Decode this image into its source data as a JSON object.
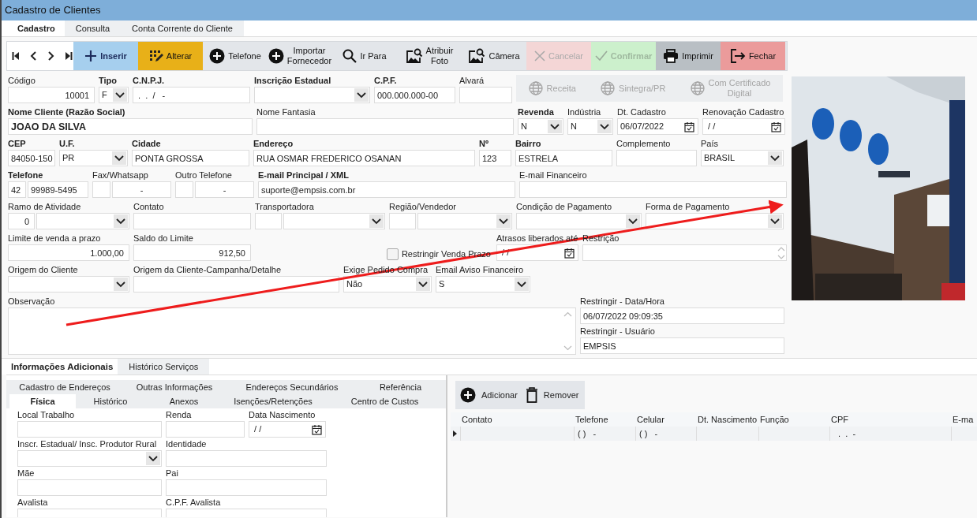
{
  "window": {
    "title": "Cadastro de Clientes"
  },
  "tabs": [
    {
      "label": "Cadastro",
      "selected": true
    },
    {
      "label": "Consulta",
      "selected": false
    },
    {
      "label": "Conta Corrente do Cliente",
      "selected": false
    }
  ],
  "toolbar": {
    "navigation": [
      {
        "kind": "first"
      },
      {
        "kind": "prev"
      },
      {
        "kind": "next"
      },
      {
        "kind": "last"
      }
    ],
    "buttons": [
      {
        "label": "Inserir",
        "kind": "add",
        "disabled": false
      },
      {
        "label": "Alterar",
        "kind": "edit",
        "disabled": false
      },
      {
        "label": "Telefone",
        "kind": "circleplus",
        "disabled": false
      },
      {
        "label": "Importar\nFornecedor",
        "kind": "circleplus",
        "disabled": false
      },
      {
        "label": "Ir Para",
        "kind": "search",
        "disabled": false
      },
      {
        "label": "Atribuir\nFoto",
        "disabled": false
      },
      {
        "label": "Câmera",
        "disabled": false
      },
      {
        "label": "Cancelar",
        "kind": "cancel",
        "disabled": true
      },
      {
        "label": "Confirmar",
        "kind": "confirm",
        "disabled": true
      },
      {
        "label": "Imprimir",
        "kind": "print",
        "disabled": false
      },
      {
        "label": "Fechar",
        "kind": "close",
        "disabled": false
      }
    ]
  },
  "form": {
    "rows": [
      {
        "fields": [
          {
            "label": "Código",
            "kind": "number",
            "value": "10001",
            "required": false
          },
          {
            "label": "Tipo",
            "kind": "select",
            "value": "F",
            "required": true
          },
          {
            "label": "C.N.P.J.",
            "kind": "text",
            "value": " .  .  /   -",
            "required": true
          },
          {
            "label": "Inscrição Estadual",
            "kind": "select",
            "required": true
          },
          {
            "label": "C.P.F.",
            "kind": "text",
            "value": "000.000.000-00",
            "required": true
          },
          {
            "label": "Alvará",
            "kind": "text",
            "required": false
          },
          {
            "kind": "lookup",
            "buttons": [
              {
                "label": "Receita",
                "disabled": true
              },
              {
                "label": "Sintegra/PR",
                "disabled": true
              },
              {
                "label": "Com Certificado\nDigital",
                "disabled": true
              }
            ]
          }
        ]
      },
      {
        "fields": [
          {
            "label": "Nome Cliente (Razão Social)",
            "kind": "text",
            "value": "JOAO DA SILVA",
            "required": true
          },
          {
            "label": "Nome Fantasia",
            "kind": "text",
            "required": false
          },
          {
            "label": "Revenda",
            "kind": "select",
            "value": "N",
            "required": true
          },
          {
            "label": "Indústria",
            "kind": "select",
            "value": "N",
            "required": false
          },
          {
            "label": "Dt. Cadastro",
            "kind": "date",
            "value": "06/07/2022",
            "required": false
          },
          {
            "label": "Renovação Cadastro",
            "kind": "date",
            "value": " / /",
            "required": false
          }
        ]
      },
      {
        "fields": [
          {
            "label": "CEP",
            "kind": "text",
            "value": "84050-150",
            "required": true
          },
          {
            "label": "U.F.",
            "kind": "select",
            "value": "PR",
            "required": true
          },
          {
            "label": "Cidade",
            "kind": "text",
            "value": "PONTA GROSSA",
            "required": true
          },
          {
            "label": "Endereço",
            "kind": "text",
            "value": "RUA OSMAR FREDERICO OSANAN",
            "required": true
          },
          {
            "label": "Nº",
            "kind": "text",
            "value": "123",
            "required": true
          },
          {
            "label": "Bairro",
            "kind": "text",
            "value": "ESTRELA",
            "required": true
          },
          {
            "label": "Complemento",
            "kind": "text",
            "required": false
          },
          {
            "label": "País",
            "kind": "select",
            "value": "BRASIL",
            "required": false
          }
        ]
      },
      {
        "fields": [
          {
            "label": "Telefone",
            "kind": "pair",
            "prefix": "42",
            "value": "99989-5495",
            "required": true
          },
          {
            "label": "Fax/Whatsapp",
            "kind": "pair",
            "value": "-",
            "required": false
          },
          {
            "label": "Outro Telefone",
            "kind": "pair",
            "value": "-",
            "required": false
          },
          {
            "label": "E-mail Principal / XML",
            "kind": "text",
            "value": "suporte@empsis.com.br",
            "required": true
          },
          {
            "label": "E-mail Financeiro",
            "kind": "text",
            "required": false
          }
        ]
      },
      {
        "fields": [
          {
            "label": "Ramo de Atividade",
            "kind": "coded_select",
            "prefix": "0",
            "required": false
          },
          {
            "label": "Contato",
            "kind": "text",
            "required": false
          },
          {
            "label": "Transportadora",
            "kind": "coded_select",
            "required": false
          },
          {
            "label": "Região/Vendedor",
            "kind": "coded_select",
            "required": false
          },
          {
            "label": "Condição de Pagamento",
            "kind": "select",
            "required": false
          },
          {
            "label": "Forma de Pagamento",
            "kind": "select",
            "required": false
          }
        ]
      },
      {
        "fields": [
          {
            "label": "Limite de venda a prazo",
            "kind": "number",
            "value": "1.000,00",
            "required": false
          },
          {
            "label": "Saldo do Limite",
            "kind": "number",
            "value": "912,50",
            "required": false
          },
          {
            "label": "Restringir Venda Prazo",
            "kind": "checkbox",
            "checked": false
          },
          {
            "label": "Atrasos liberados até",
            "kind": "date",
            "value": " / /",
            "required": false
          },
          {
            "label": "Restrição",
            "kind": "spin",
            "required": false
          }
        ]
      },
      {
        "fields": [
          {
            "label": "Origem do Cliente",
            "kind": "select",
            "required": false
          },
          {
            "label": "Origem da Cliente-Campanha/Detalhe",
            "kind": "text",
            "required": false
          },
          {
            "label": "Exige Pedido Compra",
            "kind": "select",
            "value": "Não",
            "required": false
          },
          {
            "label": "Email Aviso Financeiro",
            "kind": "select",
            "value": "S",
            "required": false
          }
        ]
      },
      {
        "fields": [
          {
            "label": "Observação",
            "kind": "textarea",
            "required": false
          },
          {
            "kind": "column",
            "fields": [
              {
                "label": "Restringir - Data/Hora",
                "kind": "text",
                "value": "06/07/2022 09:09:35",
                "required": false
              },
              {
                "label": "Restringir - Usuário",
                "kind": "text",
                "value": "EMPSIS",
                "required": false
              }
            ]
          }
        ]
      }
    ]
  },
  "bottom_tabs": [
    {
      "label": "Informações Adicionais",
      "selected": true
    },
    {
      "label": "Histórico Serviços",
      "selected": false
    }
  ],
  "sub_tabs_back": [
    {
      "label": "Cadastro de Endereços"
    },
    {
      "label": "Outras Informações"
    },
    {
      "label": "Endereços Secundários"
    },
    {
      "label": "Referência"
    }
  ],
  "sub_tabs_front": [
    {
      "label": "Física",
      "selected": true
    },
    {
      "label": "Histórico",
      "selected": false
    },
    {
      "label": "Anexos",
      "selected": false
    },
    {
      "label": "Isenções/Retenções",
      "selected": false
    },
    {
      "label": "Centro de Custos",
      "selected": false
    }
  ],
  "fisica": {
    "rows": [
      {
        "fields": [
          {
            "label": "Local Trabalho",
            "kind": "text"
          },
          {
            "label": "Renda",
            "kind": "text"
          },
          {
            "label": "Data Nascimento",
            "kind": "date",
            "value": " / /"
          }
        ]
      },
      {
        "fields": [
          {
            "label": "Inscr. Estadual/ Insc. Produtor Rural",
            "kind": "select"
          },
          {
            "label": "Identidade",
            "kind": "text"
          }
        ]
      },
      {
        "fields": [
          {
            "label": "Mãe",
            "kind": "text"
          },
          {
            "label": "Pai",
            "kind": "text"
          }
        ]
      },
      {
        "fields": [
          {
            "label": "Avalista",
            "kind": "text"
          },
          {
            "label": "C.P.F. Avalista",
            "kind": "text"
          }
        ]
      }
    ]
  },
  "contacts": {
    "buttons": [
      {
        "label": "Adicionar",
        "kind": "circleplus"
      },
      {
        "label": "Remover",
        "kind": "trash"
      }
    ],
    "columns": [
      "Contato",
      "Telefone",
      "Celular",
      "Dt. Nascimento",
      "Função",
      "CPF",
      "E-ma"
    ],
    "rows": [
      {
        "current": true,
        "cells": [
          {
            "kind": "blank"
          },
          {
            "kind": "text",
            "text": "( )   -"
          },
          {
            "kind": "text",
            "text": "( )   -"
          },
          {
            "kind": "blank"
          },
          {
            "kind": "blank"
          },
          {
            "kind": "text",
            "text": "  .  .  -"
          },
          {
            "kind": "blank"
          }
        ]
      }
    ]
  }
}
